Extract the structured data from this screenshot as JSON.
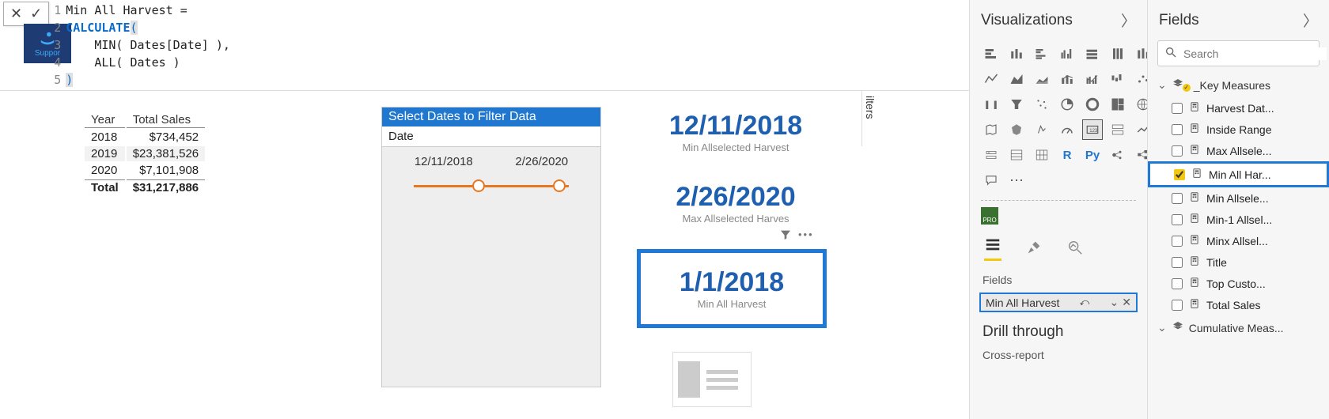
{
  "formula": {
    "line1_plain": "Min All Harvest = ",
    "line2_kw": "CALCULATE",
    "line2_paren": "(",
    "line3": "    MIN( Dates[Date] ),",
    "line4": "    ALL( Dates )",
    "line5": ")",
    "gutter": [
      "1",
      "2",
      "3",
      "4",
      "5"
    ]
  },
  "support_label": "Suppor",
  "filters_tab": "ilters",
  "table": {
    "headers": [
      "Year",
      "Total Sales"
    ],
    "rows": [
      {
        "year": "2018",
        "val": "$734,452",
        "alt": false
      },
      {
        "year": "2019",
        "val": "$23,381,526",
        "alt": true
      },
      {
        "year": "2020",
        "val": "$7,101,908",
        "alt": false
      }
    ],
    "total_label": "Total",
    "total_val": "$31,217,886"
  },
  "slicer": {
    "title": "Select Dates to Filter Data",
    "subtitle": "Date",
    "from": "12/11/2018",
    "to": "2/26/2020"
  },
  "cards": {
    "c1": {
      "val": "12/11/2018",
      "sub": "Min Allselected Harvest"
    },
    "c2": {
      "val": "2/26/2020",
      "sub": "Max Allselected Harves"
    },
    "c3": {
      "val": "1/1/2018",
      "sub": "Min All Harvest"
    }
  },
  "viz": {
    "title": "Visualizations",
    "fields_label": "Fields",
    "well_field": "Min All Harvest",
    "drill": "Drill through",
    "cross": "Cross-report",
    "py": "Py",
    "r": "R",
    "pro": "PRO"
  },
  "fields": {
    "title": "Fields",
    "search_ph": "Search",
    "group": "_Key Measures",
    "group2": "Cumulative Meas...",
    "items": [
      {
        "label": "Harvest Dat...",
        "checked": false
      },
      {
        "label": "Inside Range",
        "checked": false
      },
      {
        "label": "Max Allsele...",
        "checked": false
      },
      {
        "label": "Min All Har...",
        "checked": true,
        "sel": true
      },
      {
        "label": "Min Allsele...",
        "checked": false
      },
      {
        "label": "Min-1 Allsel...",
        "checked": false
      },
      {
        "label": "Minx Allsel...",
        "checked": false
      },
      {
        "label": "Title",
        "checked": false
      },
      {
        "label": "Top Custo...",
        "checked": false
      },
      {
        "label": "Total Sales",
        "checked": false
      }
    ]
  }
}
